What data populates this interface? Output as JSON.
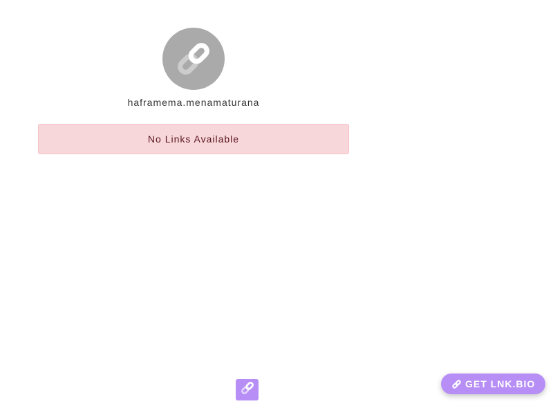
{
  "profile": {
    "avatar_icon": "link-icon",
    "username": "haframema.menamaturana"
  },
  "alert": {
    "message": "No Links Available"
  },
  "footer": {
    "logo_icon": "link-icon"
  },
  "cta": {
    "label": "GET LNK.BIO",
    "icon": "link-icon"
  },
  "colors": {
    "avatar_bg": "#aaaaaa",
    "alert_bg": "#f8d7da",
    "alert_text": "#58151c",
    "brand_purple": "#b78ef5"
  }
}
